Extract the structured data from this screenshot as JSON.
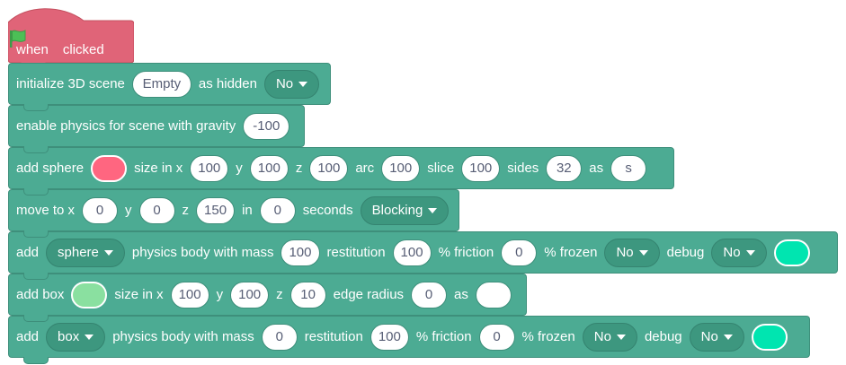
{
  "hat": {
    "when": "when",
    "clicked": "clicked"
  },
  "b1": {
    "label": "initialize 3D scene",
    "scene": "Empty",
    "as_hidden": "as hidden",
    "hidden": "No"
  },
  "b2": {
    "label": "enable physics for scene with gravity",
    "gravity": "-100"
  },
  "b3": {
    "label": "add sphere",
    "color": "#ff6680",
    "size_in_x": "size in x",
    "x": "100",
    "y_l": "y",
    "y": "100",
    "z_l": "z",
    "z": "100",
    "arc_l": "arc",
    "arc": "100",
    "slice_l": "slice",
    "slice": "100",
    "sides_l": "sides",
    "sides": "32",
    "as_l": "as",
    "name": "s"
  },
  "b4": {
    "label": "move to x",
    "x": "0",
    "y_l": "y",
    "y": "0",
    "z_l": "z",
    "z": "150",
    "in_l": "in",
    "secs": "0",
    "seconds_l": "seconds",
    "mode": "Blocking"
  },
  "b5": {
    "add": "add",
    "shape": "sphere",
    "mass_l": "physics body with mass",
    "mass": "100",
    "rest_l": "restitution",
    "rest": "100",
    "fric_l": "% friction",
    "fric": "0",
    "frozen_l": "% frozen",
    "frozen": "No",
    "debug_l": "debug",
    "debug": "No",
    "debug_color": "#00e5b0"
  },
  "b6": {
    "label": "add box",
    "color": "#8ae0a0",
    "size_in_x": "size in x",
    "x": "100",
    "y_l": "y",
    "y": "100",
    "z_l": "z",
    "z": "10",
    "edge_l": "edge radius",
    "edge": "0",
    "as_l": "as",
    "name": ""
  },
  "b7": {
    "add": "add",
    "shape": "box",
    "mass_l": "physics body with mass",
    "mass": "0",
    "rest_l": "restitution",
    "rest": "100",
    "fric_l": "% friction",
    "fric": "0",
    "frozen_l": "% frozen",
    "frozen": "No",
    "debug_l": "debug",
    "debug": "No",
    "debug_color": "#00e5b0"
  },
  "colors": {
    "block": "#4cab93",
    "hat": "#e06478",
    "flag": "#4cbf56"
  }
}
